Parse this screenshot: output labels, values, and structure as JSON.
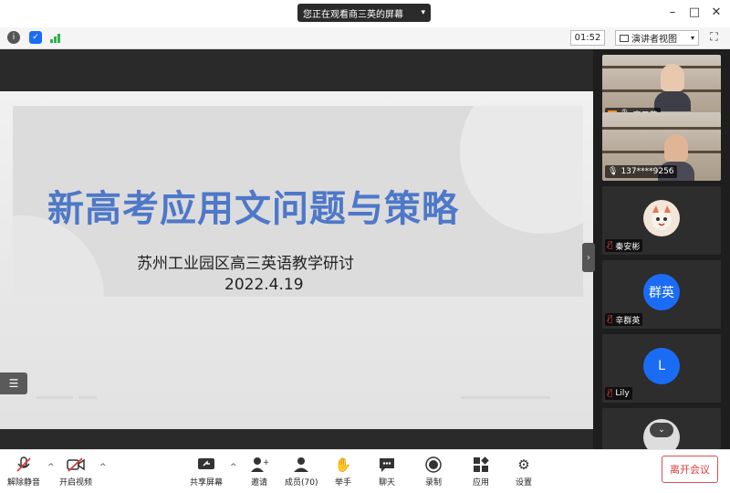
{
  "titlebar": {
    "share_notice": "您正在观看商三英的屏幕"
  },
  "toolbar": {
    "timer": "01:52",
    "view_label": "演讲者视图"
  },
  "slide": {
    "title": "新高考应用文问题与策略",
    "subtitle": "苏州工业园区高三英语教学研讨",
    "date": "2022.4.19"
  },
  "participants": [
    {
      "name": "商三英",
      "kind": "video"
    },
    {
      "name": "137****9256",
      "kind": "video"
    },
    {
      "name": "秦安彬",
      "kind": "avatar",
      "avatar_text": ""
    },
    {
      "name": "辛群英",
      "kind": "avatar",
      "avatar_text": "群英"
    },
    {
      "name": "Lily",
      "kind": "avatar",
      "avatar_text": "L"
    }
  ],
  "bottom": {
    "unmute": "解除静音",
    "start_video": "开启视频",
    "share_screen": "共享屏幕",
    "invite": "邀请",
    "members": "成员(70)",
    "raise_hand": "举手",
    "chat": "聊天",
    "record": "录制",
    "apps": "应用",
    "settings": "设置",
    "leave": "离开会议"
  },
  "colors": {
    "accent_blue": "#1a6cf5",
    "leave_red": "#e03a3a",
    "slide_title": "#4e78c8"
  }
}
